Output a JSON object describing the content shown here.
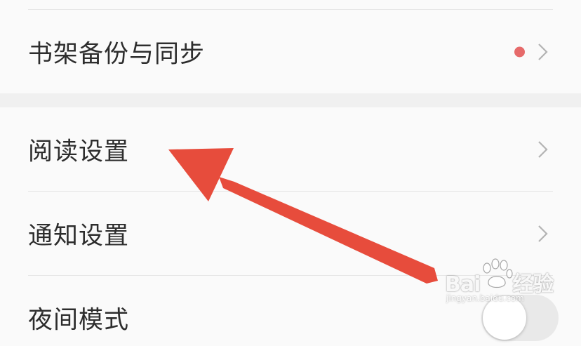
{
  "settings": {
    "items": [
      {
        "label": "书架备份与同步",
        "has_badge": true,
        "badge_color": "#e66a6a"
      },
      {
        "label": "阅读设置"
      },
      {
        "label": "通知设置"
      },
      {
        "label": "夜间模式",
        "toggle_on": false
      }
    ]
  },
  "annotation": {
    "arrow_color": "#e74c3c"
  },
  "watermark": {
    "brand_left": "Bai",
    "brand_right": "经验",
    "url": "jingyan.baidu.com"
  }
}
